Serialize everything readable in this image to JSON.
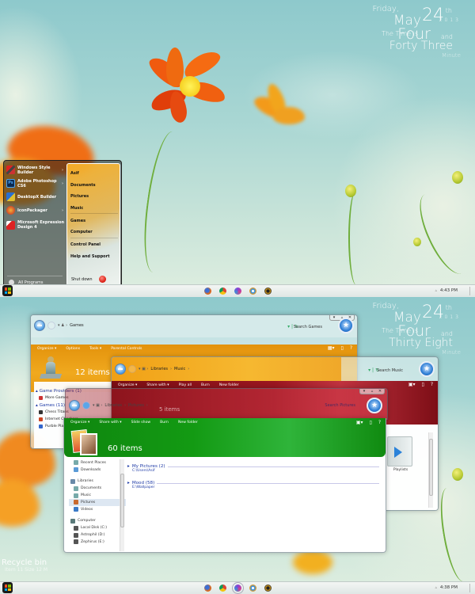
{
  "screens": [
    {
      "clock": {
        "day": "Friday,",
        "month": "May",
        "date": "24",
        "suffix": "th",
        "year": "2013",
        "time_is": "The Time is",
        "hour_word": "Four",
        "and": "and",
        "minute_words": "Forty Three",
        "minute_label": "Minute"
      },
      "start_menu": {
        "programs": [
          {
            "label": "Windows Style Builder",
            "icon": "paintbrush-icon",
            "has_submenu": true
          },
          {
            "label": "Adobe Photoshop CS6",
            "icon": "photoshop-icon",
            "has_submenu": true
          },
          {
            "label": "DesktopX Builder",
            "icon": "pencil-ruler-icon",
            "has_submenu": false
          },
          {
            "label": "IconPackager",
            "icon": "iconpackager-icon",
            "has_submenu": true
          },
          {
            "label": "Microsoft Expression Design 4",
            "icon": "expression-design-icon",
            "has_submenu": false
          }
        ],
        "all_programs": "All Programs",
        "right_links": [
          "Asif",
          "Documents",
          "Pictures",
          "Music",
          "Games",
          "Computer",
          "Control Panel",
          "Help and Support"
        ],
        "shutdown": "Shut down"
      },
      "taskbar": {
        "time": "4:43 PM",
        "pinned": [
          "firefox-icon",
          "chrome-icon",
          "media-icon",
          "rocketdock-icon",
          "winamp-icon"
        ]
      }
    },
    {
      "clock": {
        "day": "Friday,",
        "month": "May",
        "date": "24",
        "suffix": "th",
        "year": "2013",
        "time_is": "The Time is",
        "hour_word": "Four",
        "and": "and",
        "minute_words": "Thirty Eight",
        "minute_label": "Minute"
      },
      "windows": {
        "games": {
          "breadcrumb": [
            "Games"
          ],
          "search_placeholder": "Search Games",
          "commands": [
            "Organize ▾",
            "Options",
            "Tools ▾",
            "Parental Controls"
          ],
          "count": "12 items",
          "color": "#e69a10",
          "list": {
            "group1": "Game Providers (1)",
            "group1_items": [
              "More Games"
            ],
            "group2": "Games (11)",
            "group2_items": [
              "Chess Titans",
              "Internet Checkers",
              "Purble Place"
            ]
          }
        },
        "music": {
          "breadcrumb": [
            "Libraries",
            "Music"
          ],
          "search_placeholder": "Search Music",
          "commands": [
            "Organize ▾",
            "Share with ▾",
            "Play all",
            "Burn",
            "New folder"
          ],
          "color": "#7d0e16",
          "content_item": "Playlists"
        },
        "pictures_red": {
          "breadcrumb": [
            "Libraries",
            "Pictures"
          ],
          "search_placeholder": "Search Pictures",
          "count": "5 items"
        },
        "pictures": {
          "breadcrumb": [
            "Libraries",
            "Pictures"
          ],
          "search_placeholder": "Search Pictures",
          "commands": [
            "Organize ▾",
            "Share with ▾",
            "Slide show",
            "Burn",
            "New folder"
          ],
          "count": "60 items",
          "color": "#118a11",
          "nav": {
            "favorites": [
              "Recent Places",
              "Downloads"
            ],
            "libraries_label": "Libraries",
            "libraries": [
              "Documents",
              "Music",
              "Pictures",
              "Videos"
            ],
            "selected": "Pictures",
            "computer_label": "Computer",
            "drives": [
              "Local Disk (C:)",
              "Astrophil (D:)",
              "Zephirus (E:)"
            ]
          },
          "groups": [
            {
              "title": "My Pictures (2)",
              "path": "C:\\Users\\Asif"
            },
            {
              "title": "Mood (58)",
              "path": "E:\\Wallpaper"
            }
          ]
        }
      },
      "recycle_bin": {
        "title": "Recycle bin",
        "info": "Item 11  Size 12 M"
      },
      "taskbar": {
        "time": "4:38 PM",
        "pinned": [
          "firefox-icon",
          "chrome-icon",
          "media-icon",
          "rocketdock-icon",
          "winamp-icon"
        ],
        "active_index": 2
      }
    }
  ],
  "colors": {
    "accent_blue": "#1e3aa6",
    "games_orange": "#e69a10",
    "music_red": "#7d0e16",
    "pictures_green": "#118a11"
  }
}
